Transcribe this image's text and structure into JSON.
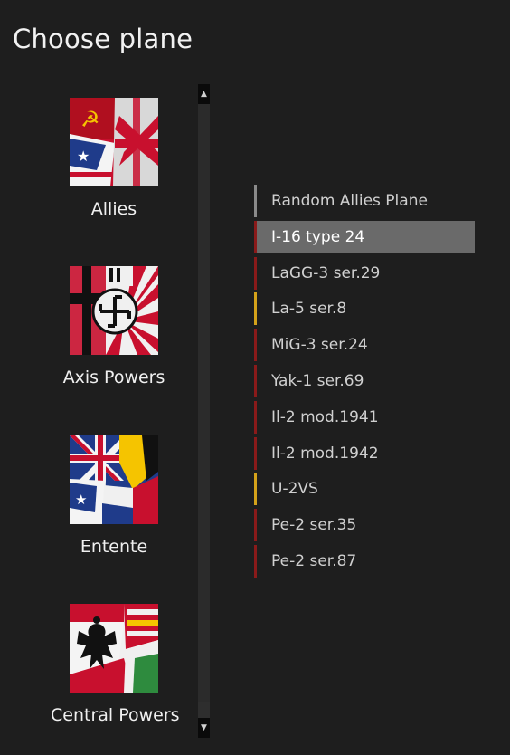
{
  "title": "Choose plane",
  "colors": {
    "soviet_red": "#8a1a1a",
    "trainer_yellow": "#d4a21a",
    "neutral_gray": "#8a8a8a",
    "selected_bg": "#6a6a6a"
  },
  "coalitions": [
    {
      "name": "Allies",
      "icon": "allies-flag-icon"
    },
    {
      "name": "Axis Powers",
      "icon": "axis-flag-icon"
    },
    {
      "name": "Entente",
      "icon": "entente-flag-icon"
    },
    {
      "name": "Central Powers",
      "icon": "central-powers-flag-icon"
    }
  ],
  "scrollbar": {
    "up": "▲",
    "down": "▼"
  },
  "planes": [
    {
      "label": "Random Allies Plane",
      "bar": "#8a8a8a",
      "selected": false
    },
    {
      "label": "I-16 type 24",
      "bar": "#8a1a1a",
      "selected": true
    },
    {
      "label": "LaGG-3 ser.29",
      "bar": "#8a1a1a",
      "selected": false
    },
    {
      "label": "La-5 ser.8",
      "bar": "#d4a21a",
      "selected": false
    },
    {
      "label": "MiG-3 ser.24",
      "bar": "#8a1a1a",
      "selected": false
    },
    {
      "label": "Yak-1 ser.69",
      "bar": "#8a1a1a",
      "selected": false
    },
    {
      "label": "Il-2 mod.1941",
      "bar": "#8a1a1a",
      "selected": false
    },
    {
      "label": "Il-2 mod.1942",
      "bar": "#8a1a1a",
      "selected": false
    },
    {
      "label": "U-2VS",
      "bar": "#d4a21a",
      "selected": false
    },
    {
      "label": "Pe-2 ser.35",
      "bar": "#8a1a1a",
      "selected": false
    },
    {
      "label": "Pe-2 ser.87",
      "bar": "#8a1a1a",
      "selected": false
    }
  ]
}
